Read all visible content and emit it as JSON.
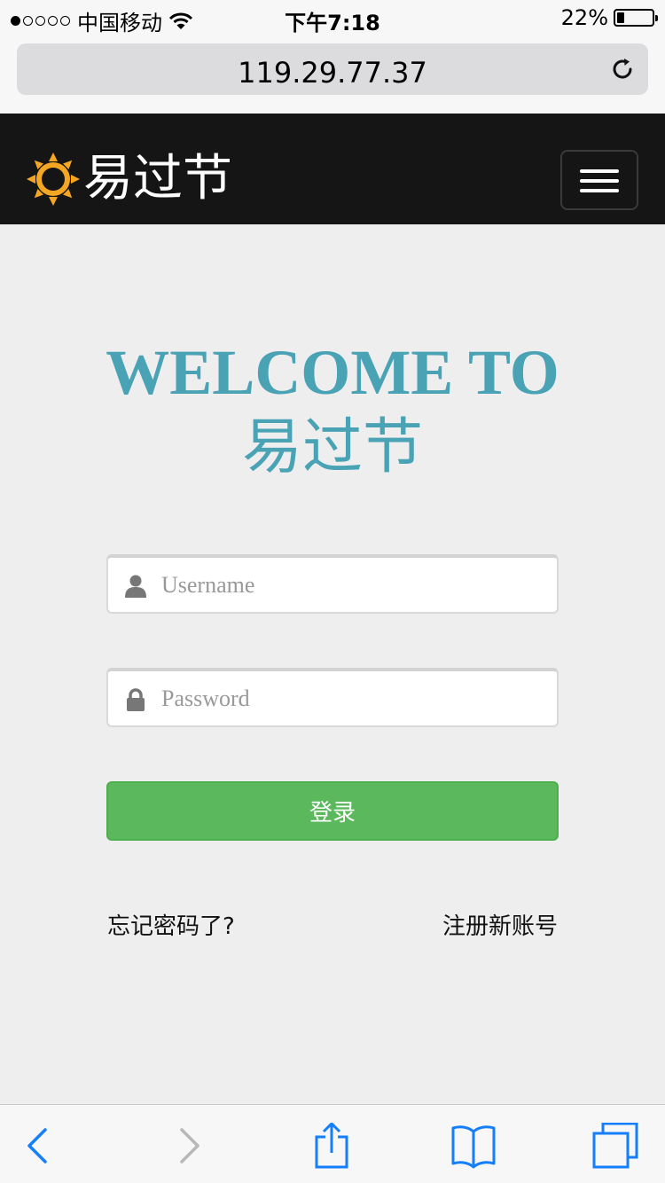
{
  "status_bar": {
    "carrier": "中国移动",
    "signal_bars_filled": 1,
    "signal_bars_total": 5,
    "time": "下午7:18",
    "battery_text": "22%",
    "battery_level": 0.22,
    "wifi_icon": "wifi-icon"
  },
  "browser": {
    "url": "119.29.77.37",
    "reload_icon": "reload-icon"
  },
  "navbar": {
    "brand_text": "易过节",
    "logo_icon": "sun-icon",
    "menu_icon": "hamburger-icon",
    "brand_color": "#f5a623"
  },
  "welcome": {
    "line1": "WELCOME TO",
    "line2": "易过节",
    "color": "#4aa3b5"
  },
  "login_form": {
    "username": {
      "placeholder": "Username",
      "value": "",
      "icon": "user-icon"
    },
    "password": {
      "placeholder": "Password",
      "value": "",
      "icon": "lock-icon"
    },
    "submit_label": "登录",
    "submit_color": "#5cb85c",
    "forgot_link": "忘记密码了?",
    "register_link": "注册新账号"
  },
  "toolbar": {
    "back_icon": "back-icon",
    "forward_icon": "forward-icon",
    "share_icon": "share-icon",
    "bookmarks_icon": "bookmarks-icon",
    "tabs_icon": "tabs-icon",
    "accent": "#147efb"
  }
}
